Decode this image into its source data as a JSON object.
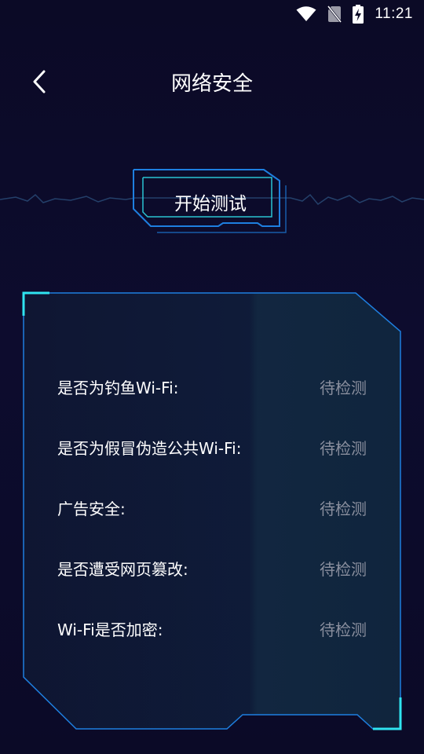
{
  "status_bar": {
    "time": "11:21",
    "icons": [
      "wifi-icon",
      "no-sim-icon",
      "battery-charging-icon"
    ]
  },
  "header": {
    "title": "网络安全",
    "back_icon": "chevron-left-icon"
  },
  "start_button": {
    "label": "开始测试"
  },
  "checks": [
    {
      "label": "是否为钓鱼Wi-Fi:",
      "status": "待检测"
    },
    {
      "label": "是否为假冒伪造公共Wi-Fi:",
      "status": "待检测"
    },
    {
      "label": "广告安全:",
      "status": "待检测"
    },
    {
      "label": "是否遭受网页篡改:",
      "status": "待检测"
    },
    {
      "label": "Wi-Fi是否加密:",
      "status": "待检测"
    }
  ],
  "colors": {
    "background": "#0c0b2a",
    "accent_cyan": "#2fe4f0",
    "accent_blue": "#1e7fe0",
    "status_gray": "#8a8f9e"
  }
}
